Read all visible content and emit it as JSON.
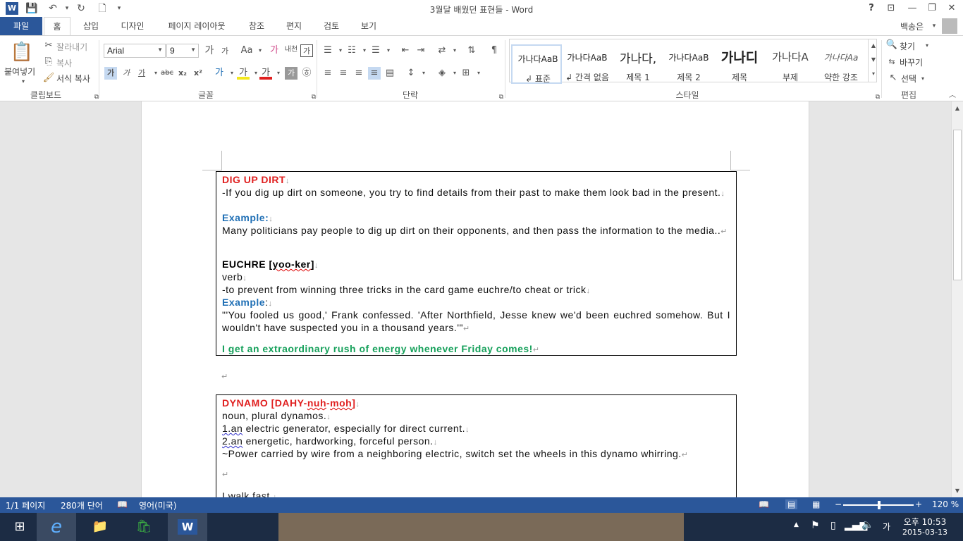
{
  "window": {
    "title": "3월달 배웠던 표현들 - Word",
    "help": "?",
    "user": "백송은"
  },
  "tabs": [
    {
      "label": "파일"
    },
    {
      "label": "홈"
    },
    {
      "label": "삽입"
    },
    {
      "label": "디자인"
    },
    {
      "label": "페이지 레이아웃"
    },
    {
      "label": "참조"
    },
    {
      "label": "편지"
    },
    {
      "label": "검토"
    },
    {
      "label": "보기"
    }
  ],
  "ribbon": {
    "clipboard": {
      "paste": "붙여넣기",
      "cut": "잘라내기",
      "copy": "복사",
      "format_painter": "서식 복사",
      "label": "클립보드"
    },
    "font": {
      "name": "Arial",
      "size": "9",
      "grow": "가",
      "shrink": "가",
      "case": "Aa",
      "clear": "가",
      "phonetic": "내천",
      "border": "가",
      "bold": "가",
      "italic": "가",
      "underline": "가",
      "strike": "abc",
      "sub": "x₂",
      "sup": "x²",
      "effects": "가",
      "highlight": "가",
      "color": "가",
      "shade": "가",
      "enclose": "㉭",
      "label": "글꼴"
    },
    "paragraph": {
      "label": "단락"
    },
    "styles": {
      "items": [
        {
          "preview": "가나다AaB",
          "name": "↲ 표준"
        },
        {
          "preview": "가나다AaB",
          "name": "↲ 간격 없음"
        },
        {
          "preview": "가나다,",
          "name": "제목 1"
        },
        {
          "preview": "가나다AaB",
          "name": "제목 2"
        },
        {
          "preview": "가나디",
          "name": "제목"
        },
        {
          "preview": "가나다A",
          "name": "부제"
        },
        {
          "preview": "가나다Aa",
          "name": "약한 강조"
        }
      ],
      "label": "스타일"
    },
    "editing": {
      "find": "찾기",
      "replace": "바꾸기",
      "select": "선택",
      "label": "편집"
    }
  },
  "document": {
    "box1": {
      "title": "DIG UP DIRT",
      "def": "-If you dig up dirt on someone, you try to find details from their past to make them look bad in the present.",
      "example_label": "Example:",
      "example": "Many politicians pay people to dig up dirt on their opponents, and then pass the information to the media..",
      "term": "EUCHRE [",
      "term_pron": "yoo-ker",
      "term_end": "]",
      "pos": "verb",
      "def2": "-to prevent from winning three tricks in the card game euchre/to cheat or trick",
      "example2_label": "Example",
      "example2_colon": ":",
      "example2": "\"'You fooled us good,' Frank confessed. 'After Northfield, Jesse knew we'd been euchred somehow. But I wouldn't have suspected you in a thousand years.'\"",
      "quote": "I get an extraordinary rush of energy whenever Friday comes!"
    },
    "box2": {
      "title_a": "DYNAMO [DAHY-",
      "title_b": "nuh",
      "title_c": "-",
      "title_d": "moh",
      "title_e": "]",
      "pos": "noun, plural dynamos.",
      "num1": "1.an",
      "def1": " electric generator, especially for direct current.",
      "num2": "2.an",
      "def2": " energetic, hardworking, forceful person.",
      "example": "~Power carried by wire from a neighboring electric, switch set the wheels in this dynamo whirring.",
      "last": "I walk fast."
    }
  },
  "status": {
    "page": "1/1 페이지",
    "words": "280개 단어",
    "lang": "영어(미국)",
    "zoom": "120 %"
  },
  "taskbar": {
    "time": "오후 10:53",
    "date": "2015-03-13",
    "ime": "가"
  }
}
